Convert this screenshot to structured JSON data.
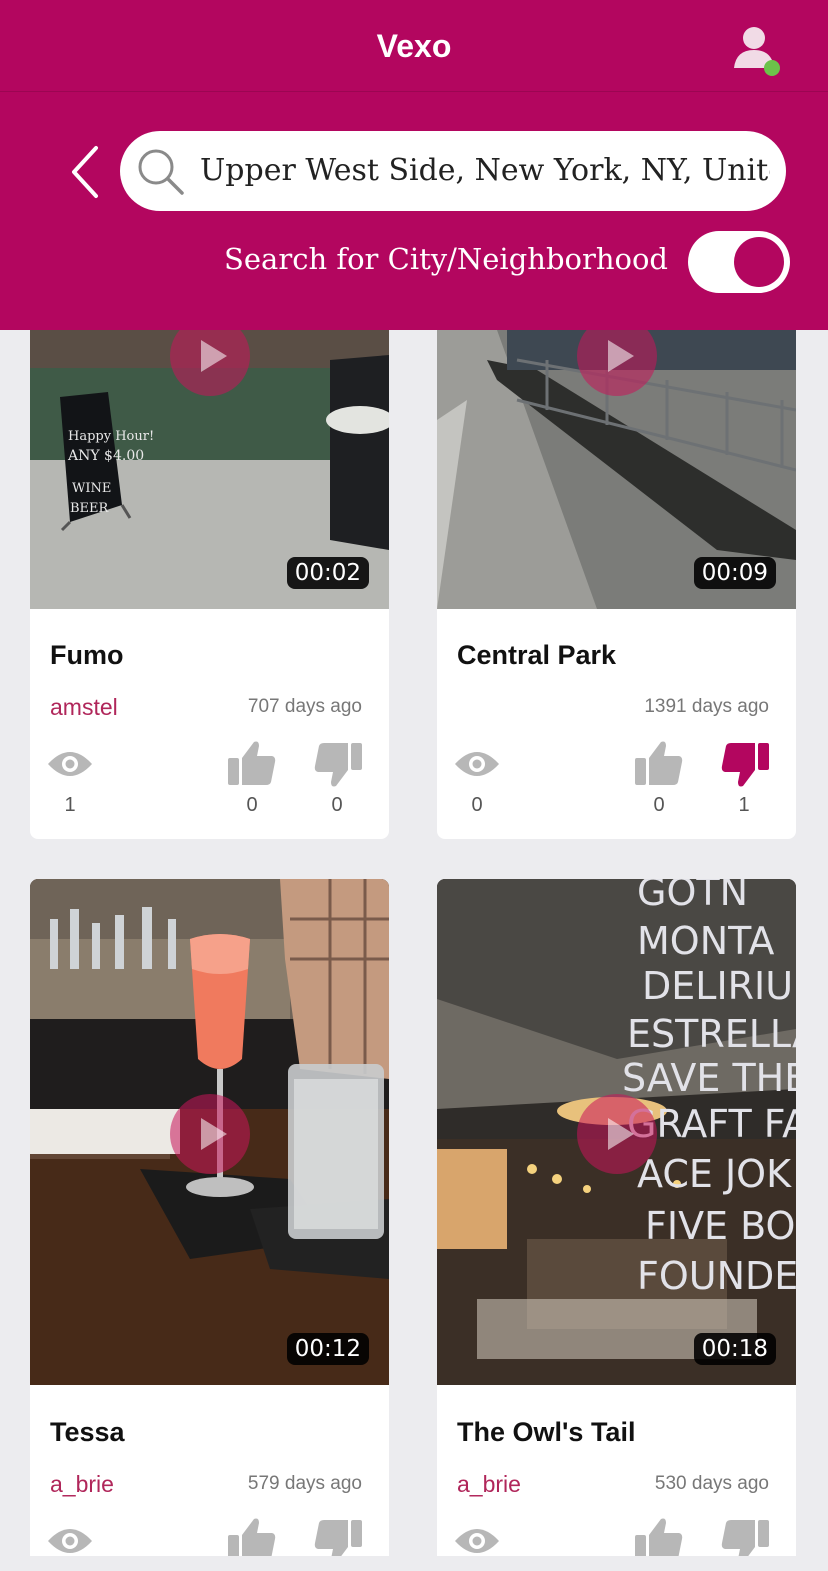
{
  "app": {
    "title": "Vexo",
    "accent_color": "#b3065f"
  },
  "search": {
    "value": "Upper West Side, New York, NY, Unite...",
    "toggle_label": "Search for City/Neighborhood",
    "toggle_on": true
  },
  "videos": [
    {
      "title": "Fumo",
      "user": "amstel",
      "posted": "707 days ago",
      "duration": "00:02",
      "views": "1",
      "likes": "0",
      "dislikes": "0",
      "disliked": false
    },
    {
      "title": "Central Park",
      "user": "",
      "posted": "1391 days ago",
      "duration": "00:09",
      "views": "0",
      "likes": "0",
      "dislikes": "1",
      "disliked": true
    },
    {
      "title": "Tessa",
      "user": "a_brie",
      "posted": "579 days ago",
      "duration": "00:12"
    },
    {
      "title": "The Owl's Tail",
      "user": "a_brie",
      "posted": "530 days ago",
      "duration": "00:18"
    }
  ],
  "icons": [
    "user-profile-icon",
    "back-chevron-icon",
    "search-icon",
    "eye-icon",
    "thumbs-up-icon",
    "thumbs-down-icon",
    "play-icon"
  ]
}
